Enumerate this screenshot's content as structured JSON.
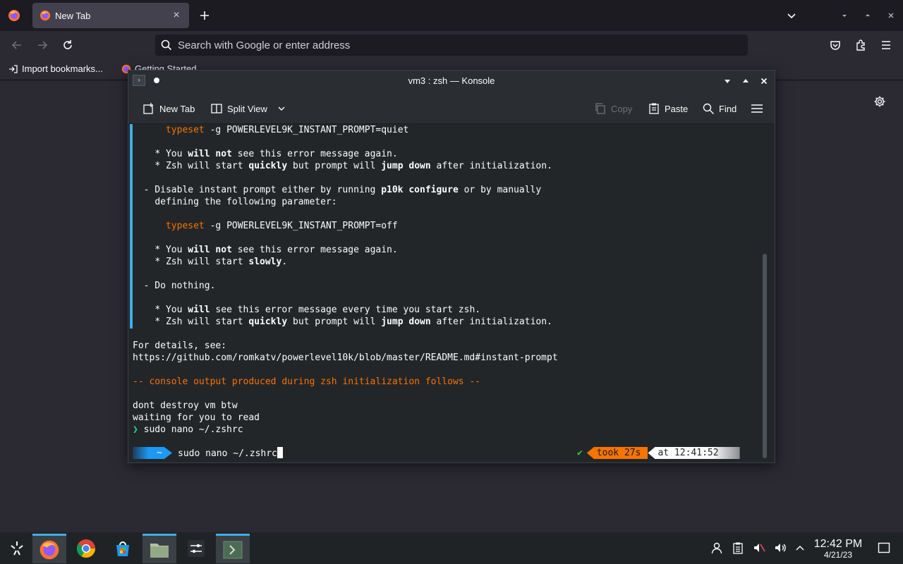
{
  "firefox": {
    "tab_title": "New Tab",
    "url_placeholder": "Search with Google or enter address",
    "bookmarks": [
      "Import bookmarks...",
      "Getting Started"
    ]
  },
  "konsole": {
    "title": "vm3 : zsh — Konsole",
    "toolbar": {
      "new_tab": "New Tab",
      "split_view": "Split View",
      "copy": "Copy",
      "paste": "Paste",
      "find": "Find"
    },
    "terminal": {
      "l1_cmd": "typeset",
      "l1_rest": " -g POWERLEVEL9K_INSTANT_PROMPT=quiet",
      "l2_a": "* You ",
      "l2_b": "will not",
      "l2_c": " see this error message again.",
      "l3_a": "* Zsh will start ",
      "l3_b": "quickly",
      "l3_c": " but prompt will ",
      "l3_d": "jump down",
      "l3_e": " after initialization.",
      "l4_a": "- Disable instant prompt either by running ",
      "l4_b": "p10k configure",
      "l4_c": " or by manually",
      "l5": "defining the following parameter:",
      "l6_cmd": "typeset",
      "l6_rest": " -g POWERLEVEL9K_INSTANT_PROMPT=off",
      "l7_a": "* You ",
      "l7_b": "will not",
      "l7_c": " see this error message again.",
      "l8_a": "* Zsh will start ",
      "l8_b": "slowly",
      "l8_c": ".",
      "l9": "- Do nothing.",
      "l10_a": "* You ",
      "l10_b": "will",
      "l10_c": " see this error message every time you start zsh.",
      "l11_a": "* Zsh will start ",
      "l11_b": "quickly",
      "l11_c": " but prompt will ",
      "l11_d": "jump down",
      "l11_e": " after initialization.",
      "l12": "For details, see:",
      "l13": "https://github.com/romkatv/powerlevel10k/blob/master/README.md#instant-prompt",
      "l14": "-- console output produced during zsh initialization follows --",
      "l15": "dont destroy vm btw",
      "l16": "waiting for you to read",
      "l17_arrow": "❯",
      "l17_cmd": " sudo nano ~/.zshrc",
      "prompt_dir": "~",
      "prompt_input": "sudo nano ~/.zshrc",
      "prompt_check": "✔",
      "prompt_took": "took 27s",
      "prompt_time": "at 12:41:52"
    }
  },
  "taskbar": {
    "time": "12:42 PM",
    "date": "4/21/23"
  }
}
